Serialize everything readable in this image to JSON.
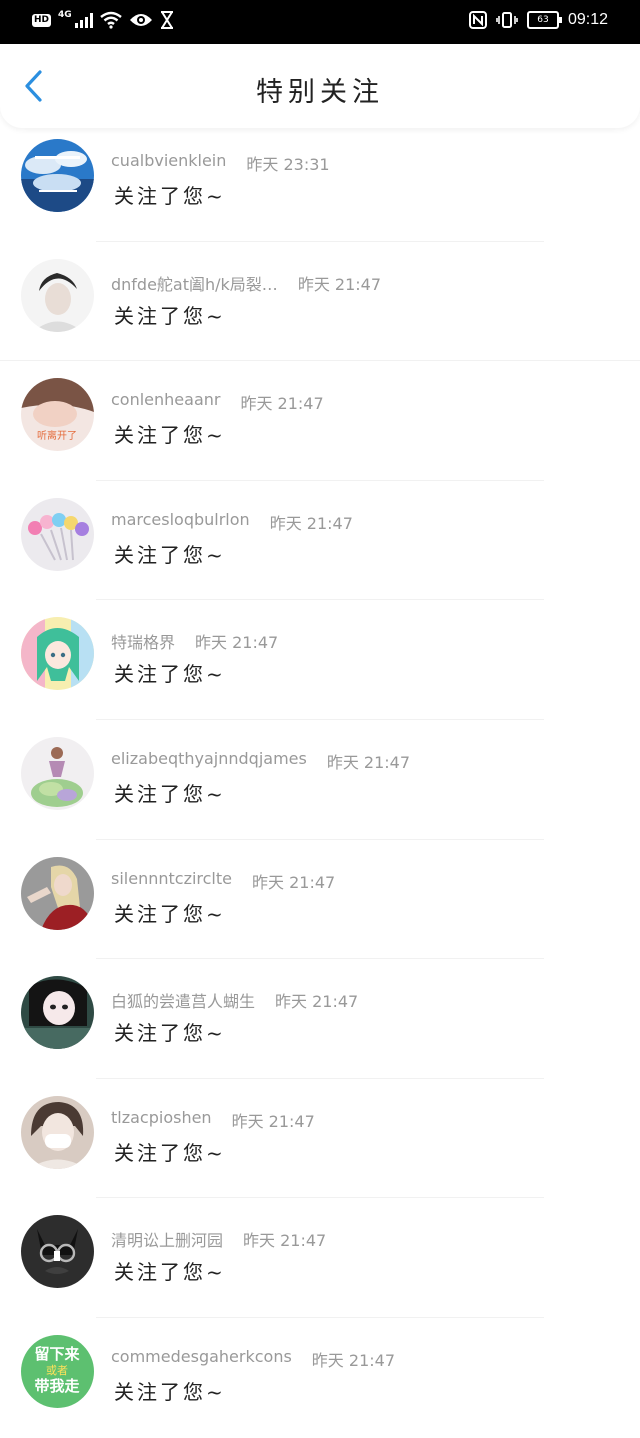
{
  "status_bar": {
    "hd": "HD",
    "network": "4G",
    "battery": "63",
    "time": "09:12"
  },
  "header": {
    "title": "特别关注"
  },
  "notifications": [
    {
      "name": "cualbvienklein",
      "time": "昨天 23:31",
      "message": "关注了您~"
    },
    {
      "name": "dnfde舵at阖h/k局裂…",
      "time": "昨天 21:47",
      "message": "关注了您~"
    },
    {
      "name": "conlenheaanr",
      "time": "昨天 21:47",
      "message": "关注了您~"
    },
    {
      "name": "marcesloqbulrlon",
      "time": "昨天 21:47",
      "message": "关注了您~"
    },
    {
      "name": "特瑞格界",
      "time": "昨天 21:47",
      "message": "关注了您~"
    },
    {
      "name": "elizabeqthyajnndqjames",
      "time": "昨天 21:47",
      "message": "关注了您~"
    },
    {
      "name": "silennntczirclte",
      "time": "昨天 21:47",
      "message": "关注了您~"
    },
    {
      "name": "白狐的尝遣莒人蝴生",
      "time": "昨天 21:47",
      "message": "关注了您~"
    },
    {
      "name": "tlzacpioshen",
      "time": "昨天 21:47",
      "message": "关注了您~"
    },
    {
      "name": "清明讼上删河园",
      "time": "昨天 21:47",
      "message": "关注了您~"
    },
    {
      "name": "commedesgaherkcons",
      "time": "昨天 21:47",
      "message": "关注了您~"
    }
  ],
  "avatar_texts": {
    "a3": "听离开了",
    "a11_line1": "留下来",
    "a11_line2": "或者",
    "a11_line3": "带我走"
  },
  "colors": {
    "accent_back": "#2b8fe0",
    "name_gray": "#999999",
    "message": "#222222"
  }
}
